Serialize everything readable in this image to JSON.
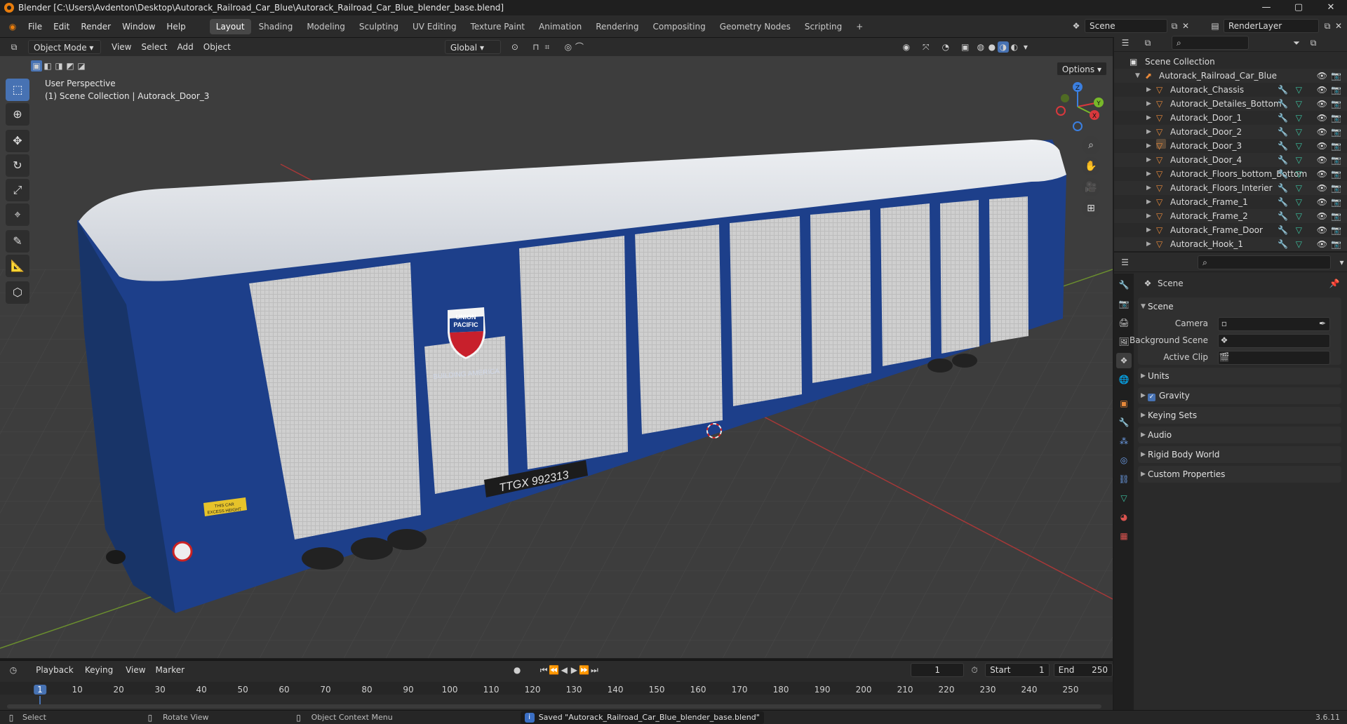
{
  "window": {
    "title": "Blender [C:\\Users\\Avdenton\\Desktop\\Autorack_Railroad_Car_Blue\\Autorack_Railroad_Car_Blue_blender_base.blend]",
    "minimize": "—",
    "maximize": "▢",
    "close": "✕"
  },
  "menu": [
    "File",
    "Edit",
    "Render",
    "Window",
    "Help"
  ],
  "workspaces": [
    "Layout",
    "Shading",
    "Modeling",
    "Sculpting",
    "UV Editing",
    "Texture Paint",
    "Animation",
    "Rendering",
    "Compositing",
    "Geometry Nodes",
    "Scripting"
  ],
  "workspace_add": "+",
  "scene_field": "Scene",
  "renderlayer_field": "RenderLayer",
  "viewport_header": {
    "mode": "Object Mode",
    "menus": [
      "View",
      "Select",
      "Add",
      "Object"
    ],
    "transform_orientation": "Global",
    "options": "Options"
  },
  "viewport": {
    "perspective": "User Perspective",
    "collection_info": "(1) Scene Collection | Autorack_Door_3"
  },
  "model": {
    "logo_line1": "UNION",
    "logo_line2": "PACIFIC",
    "slogan": "BUILDING AMERICA",
    "car_number": "TTGX  992313",
    "warning_line1": "THIS CAR",
    "warning_line2": "EXCESS HEIGHT"
  },
  "gizmo": {
    "x": "X",
    "y": "Y",
    "z": "Z"
  },
  "outliner": {
    "root": "Scene Collection",
    "collection": "Autorack_Railroad_Car_Blue",
    "items": [
      "Autorack_Chassis",
      "Autorack_Detailes_Bottom",
      "Autorack_Door_1",
      "Autorack_Door_2",
      "Autorack_Door_3",
      "Autorack_Door_4",
      "Autorack_Floors_bottom_Bottom",
      "Autorack_Floors_Interier",
      "Autorack_Frame_1",
      "Autorack_Frame_2",
      "Autorack_Frame_Door",
      "Autorack_Hook_1"
    ]
  },
  "properties": {
    "breadcrumb": "Scene",
    "panel_title": "Scene",
    "fields": [
      "Camera",
      "Background Scene",
      "Active Clip"
    ],
    "sections": [
      "Units",
      "Gravity",
      "Keying Sets",
      "Audio",
      "Rigid Body World",
      "Custom Properties"
    ]
  },
  "timeline": {
    "menus": [
      "Playback",
      "Keying",
      "View",
      "Marker"
    ],
    "current_frame": "1",
    "start_label": "Start",
    "start": "1",
    "end_label": "End",
    "end": "250",
    "ticks": [
      "1",
      "10",
      "20",
      "30",
      "40",
      "50",
      "60",
      "70",
      "80",
      "90",
      "100",
      "110",
      "120",
      "130",
      "140",
      "150",
      "160",
      "170",
      "180",
      "190",
      "200",
      "210",
      "220",
      "230",
      "240",
      "250"
    ]
  },
  "statusbar": {
    "select": "Select",
    "rotate": "Rotate View",
    "context": "Object Context Menu",
    "message": "Saved \"Autorack_Railroad_Car_Blue_blender_base.blend\"",
    "version": "3.6.11"
  },
  "colors": {
    "accent": "#4772b3",
    "car_blue": "#1d3f8a",
    "roof": "#dfe3e8",
    "object_orange": "#e8893a"
  }
}
